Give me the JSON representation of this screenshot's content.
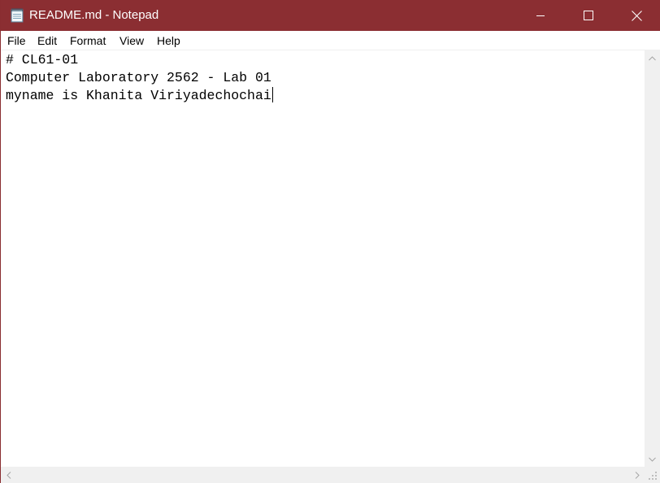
{
  "window": {
    "title": "README.md - Notepad",
    "app_icon": "notepad-icon",
    "titlebar_color": "#8b2e32",
    "controls": {
      "minimize_icon": "minimize-icon",
      "maximize_icon": "maximize-icon",
      "close_icon": "close-icon"
    }
  },
  "menu": {
    "items": [
      {
        "label": "File"
      },
      {
        "label": "Edit"
      },
      {
        "label": "Format"
      },
      {
        "label": "View"
      },
      {
        "label": "Help"
      }
    ]
  },
  "editor": {
    "lines": [
      "# CL61-01",
      "Computer Laboratory 2562 - Lab 01",
      "myname is Khanita Viriyadechochai"
    ],
    "caret_line": 3
  },
  "scrollbars": {
    "vertical": {
      "up_icon": "chevron-up-icon",
      "down_icon": "chevron-down-icon"
    },
    "horizontal": {
      "left_icon": "chevron-left-icon",
      "right_icon": "chevron-right-icon"
    },
    "grip_icon": "size-grip-icon"
  }
}
